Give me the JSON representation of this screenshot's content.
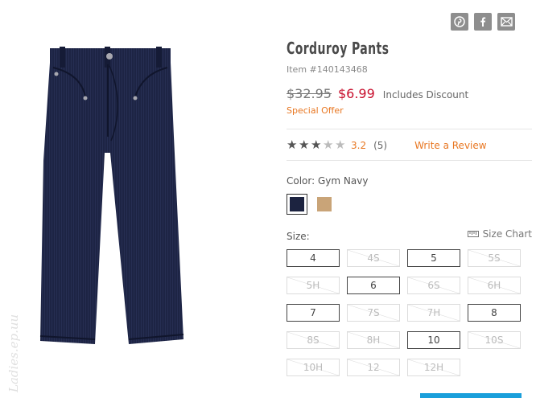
{
  "share": {
    "icons": [
      "pinterest-icon",
      "facebook-icon",
      "email-icon"
    ]
  },
  "product": {
    "title": "Corduroy Pants",
    "item_number": "Item #140143468",
    "original_price": "$32.95",
    "sale_price": "$6.99",
    "discount_note": "Includes Discount",
    "special_offer": "Special Offer",
    "rating": {
      "value": "3.2",
      "count": "(5)",
      "stars_filled": 3.2,
      "stars_total": 5
    },
    "write_review": "Write a Review",
    "color_label": "Color: Gym Navy",
    "colors": [
      {
        "name": "Gym Navy",
        "hex": "#1c2340",
        "selected": true
      },
      {
        "name": "Tan",
        "hex": "#c9a478",
        "selected": false
      }
    ],
    "size_label": "Size:",
    "size_chart_label": "Size Chart",
    "sizes": [
      {
        "label": "4",
        "available": true
      },
      {
        "label": "4S",
        "available": false
      },
      {
        "label": "5",
        "available": true
      },
      {
        "label": "5S",
        "available": false
      },
      {
        "label": "5H",
        "available": false
      },
      {
        "label": "6",
        "available": true
      },
      {
        "label": "6S",
        "available": false
      },
      {
        "label": "6H",
        "available": false
      },
      {
        "label": "7",
        "available": true
      },
      {
        "label": "7S",
        "available": false
      },
      {
        "label": "7H",
        "available": false
      },
      {
        "label": "8",
        "available": true
      },
      {
        "label": "8S",
        "available": false
      },
      {
        "label": "8H",
        "available": false
      },
      {
        "label": "10",
        "available": true
      },
      {
        "label": "10S",
        "available": false
      },
      {
        "label": "10H",
        "available": false
      },
      {
        "label": "12",
        "available": false
      },
      {
        "label": "12H",
        "available": false
      }
    ]
  },
  "watermark": "Ladies.ep.uu",
  "colors": {
    "accent_orange": "#e87722",
    "sale_red": "#c8102e",
    "cart_blue": "#1a9fdb"
  }
}
